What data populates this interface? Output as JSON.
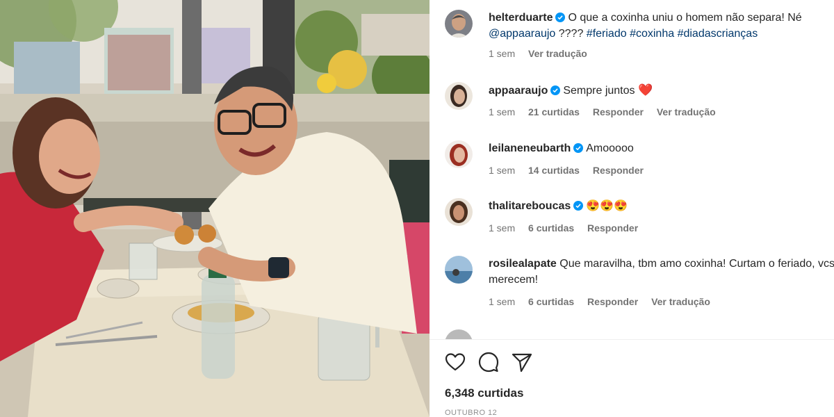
{
  "post": {
    "likes_label": "6,348 curtidas",
    "date_label": "OUTUBRO 12"
  },
  "caption": {
    "username": "helterduarte",
    "text_part1": "O que a coxinha uniu o homem não separa! Né ",
    "mention": "@appaaraujo",
    "text_part2": " ???? ",
    "hashtags": [
      "#feriado",
      "#coxinha",
      "#diadascrianças"
    ],
    "time": "1 sem",
    "translate": "Ver tradução"
  },
  "comments": [
    {
      "username": "appaaraujo",
      "text": "Sempre juntos ",
      "emoji": "❤️",
      "time": "1 sem",
      "likes": "21 curtidas",
      "reply": "Responder",
      "translate": "Ver tradução"
    },
    {
      "username": "leilaneneubarth",
      "text": "Amooooo",
      "time": "1 sem",
      "likes": "14 curtidas",
      "reply": "Responder"
    },
    {
      "username": "thalitareboucas",
      "emoji": "😍😍😍",
      "time": "1 sem",
      "likes": "6 curtidas",
      "reply": "Responder"
    },
    {
      "username": "rosilealapate",
      "text": "Que maravilha, tbm amo coxinha! Curtam o feriado, vcs merecem!",
      "time": "1 sem",
      "likes": "6 curtidas",
      "reply": "Responder",
      "translate": "Ver tradução"
    }
  ],
  "icons": {
    "like": "heart-icon",
    "comment": "comment-icon",
    "share": "share-icon",
    "verified": "verified-badge-icon"
  },
  "colors": {
    "verified": "#0095f6",
    "link": "#00376b",
    "meta": "#737373"
  }
}
